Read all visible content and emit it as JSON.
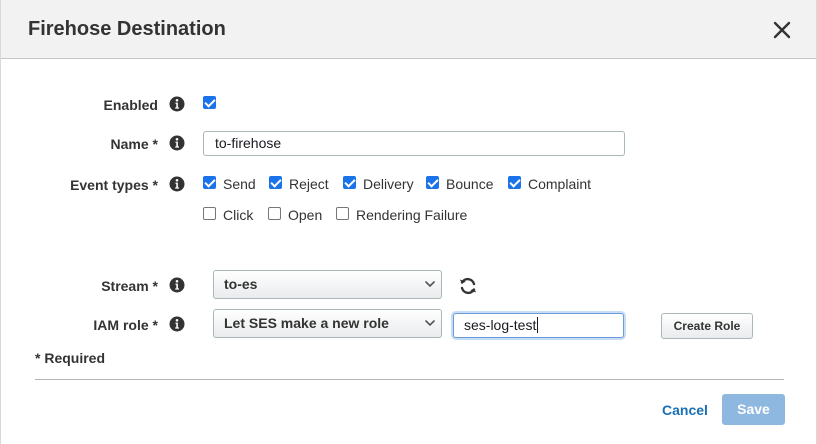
{
  "dialog": {
    "title": "Firehose Destination",
    "close_icon": "close-icon"
  },
  "form": {
    "enabled": {
      "label": "Enabled",
      "checked": true
    },
    "name": {
      "label": "Name *",
      "value": "to-firehose"
    },
    "event_types": {
      "label": "Event types *",
      "options": [
        {
          "label": "Send",
          "checked": true
        },
        {
          "label": "Reject",
          "checked": true
        },
        {
          "label": "Delivery",
          "checked": true
        },
        {
          "label": "Bounce",
          "checked": true
        },
        {
          "label": "Complaint",
          "checked": true
        },
        {
          "label": "Click",
          "checked": false
        },
        {
          "label": "Open",
          "checked": false
        },
        {
          "label": "Rendering Failure",
          "checked": false
        }
      ]
    },
    "stream": {
      "label": "Stream *",
      "selected": "to-es",
      "refresh_icon": "refresh-icon"
    },
    "iam_role": {
      "label": "IAM role *",
      "selected": "Let SES make a new role",
      "role_name_value": "ses-log-test",
      "create_role_label": "Create Role"
    },
    "required_note": "* Required"
  },
  "footer": {
    "cancel_label": "Cancel",
    "save_label": "Save"
  },
  "colors": {
    "checkbox_accent": "#1a73e8",
    "link": "#1b6fb5",
    "primary_disabled": "#8fb8e0",
    "header_bg": "#f2f2f2"
  }
}
